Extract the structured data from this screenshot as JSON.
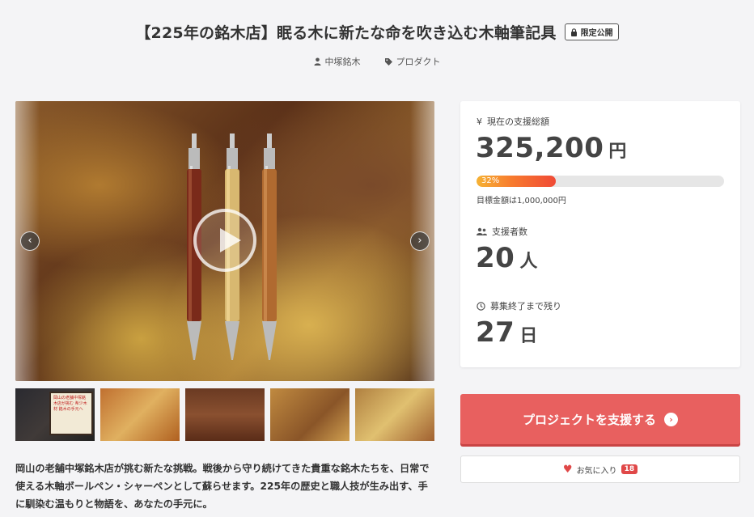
{
  "header": {
    "title": "【225年の銘木店】眠る木に新たな命を吹き込む木軸筆記具",
    "badge_label": "限定公開",
    "owner": "中塚銘木",
    "category": "プロダクト"
  },
  "media": {
    "prev_arrow": "‹",
    "next_arrow": "›",
    "thumbnail_note": "岡山の老舗中塚銘木店が挑む 希少木材 銘木の手元へ"
  },
  "description": "岡山の老舗中塚銘木店が挑む新たな挑戦。戦後から守り続けてきた貴重な銘木たちを、日常で使える木軸ボールペン・シャーペンとして蘇らせます。225年の歴史と職人技が生み出す、手に馴染む温もりと物語を、あなたの手元に。",
  "stats": {
    "amount_label": "現在の支援総額",
    "amount_value": "325,200",
    "amount_unit": "円",
    "progress_percent": 32,
    "progress_label": "32%",
    "goal_text": "目標金額は1,000,000円",
    "supporters_label": "支援者数",
    "supporters_value": "20",
    "supporters_unit": "人",
    "remaining_label": "募集終了まで残り",
    "remaining_value": "27",
    "remaining_unit": "日"
  },
  "actions": {
    "support_label": "プロジェクトを支援する",
    "favorite_label": "お気に入り",
    "favorite_count": "18"
  },
  "colors": {
    "accent": "#e8605f",
    "progress_start": "#f6b234",
    "progress_end": "#f04a36"
  },
  "icons": [
    "lock-icon",
    "user-icon",
    "tag-icon",
    "play-icon",
    "chevron-left-icon",
    "chevron-right-icon",
    "yen-icon",
    "users-icon",
    "clock-icon",
    "arrow-right-circle-icon",
    "heart-icon"
  ]
}
